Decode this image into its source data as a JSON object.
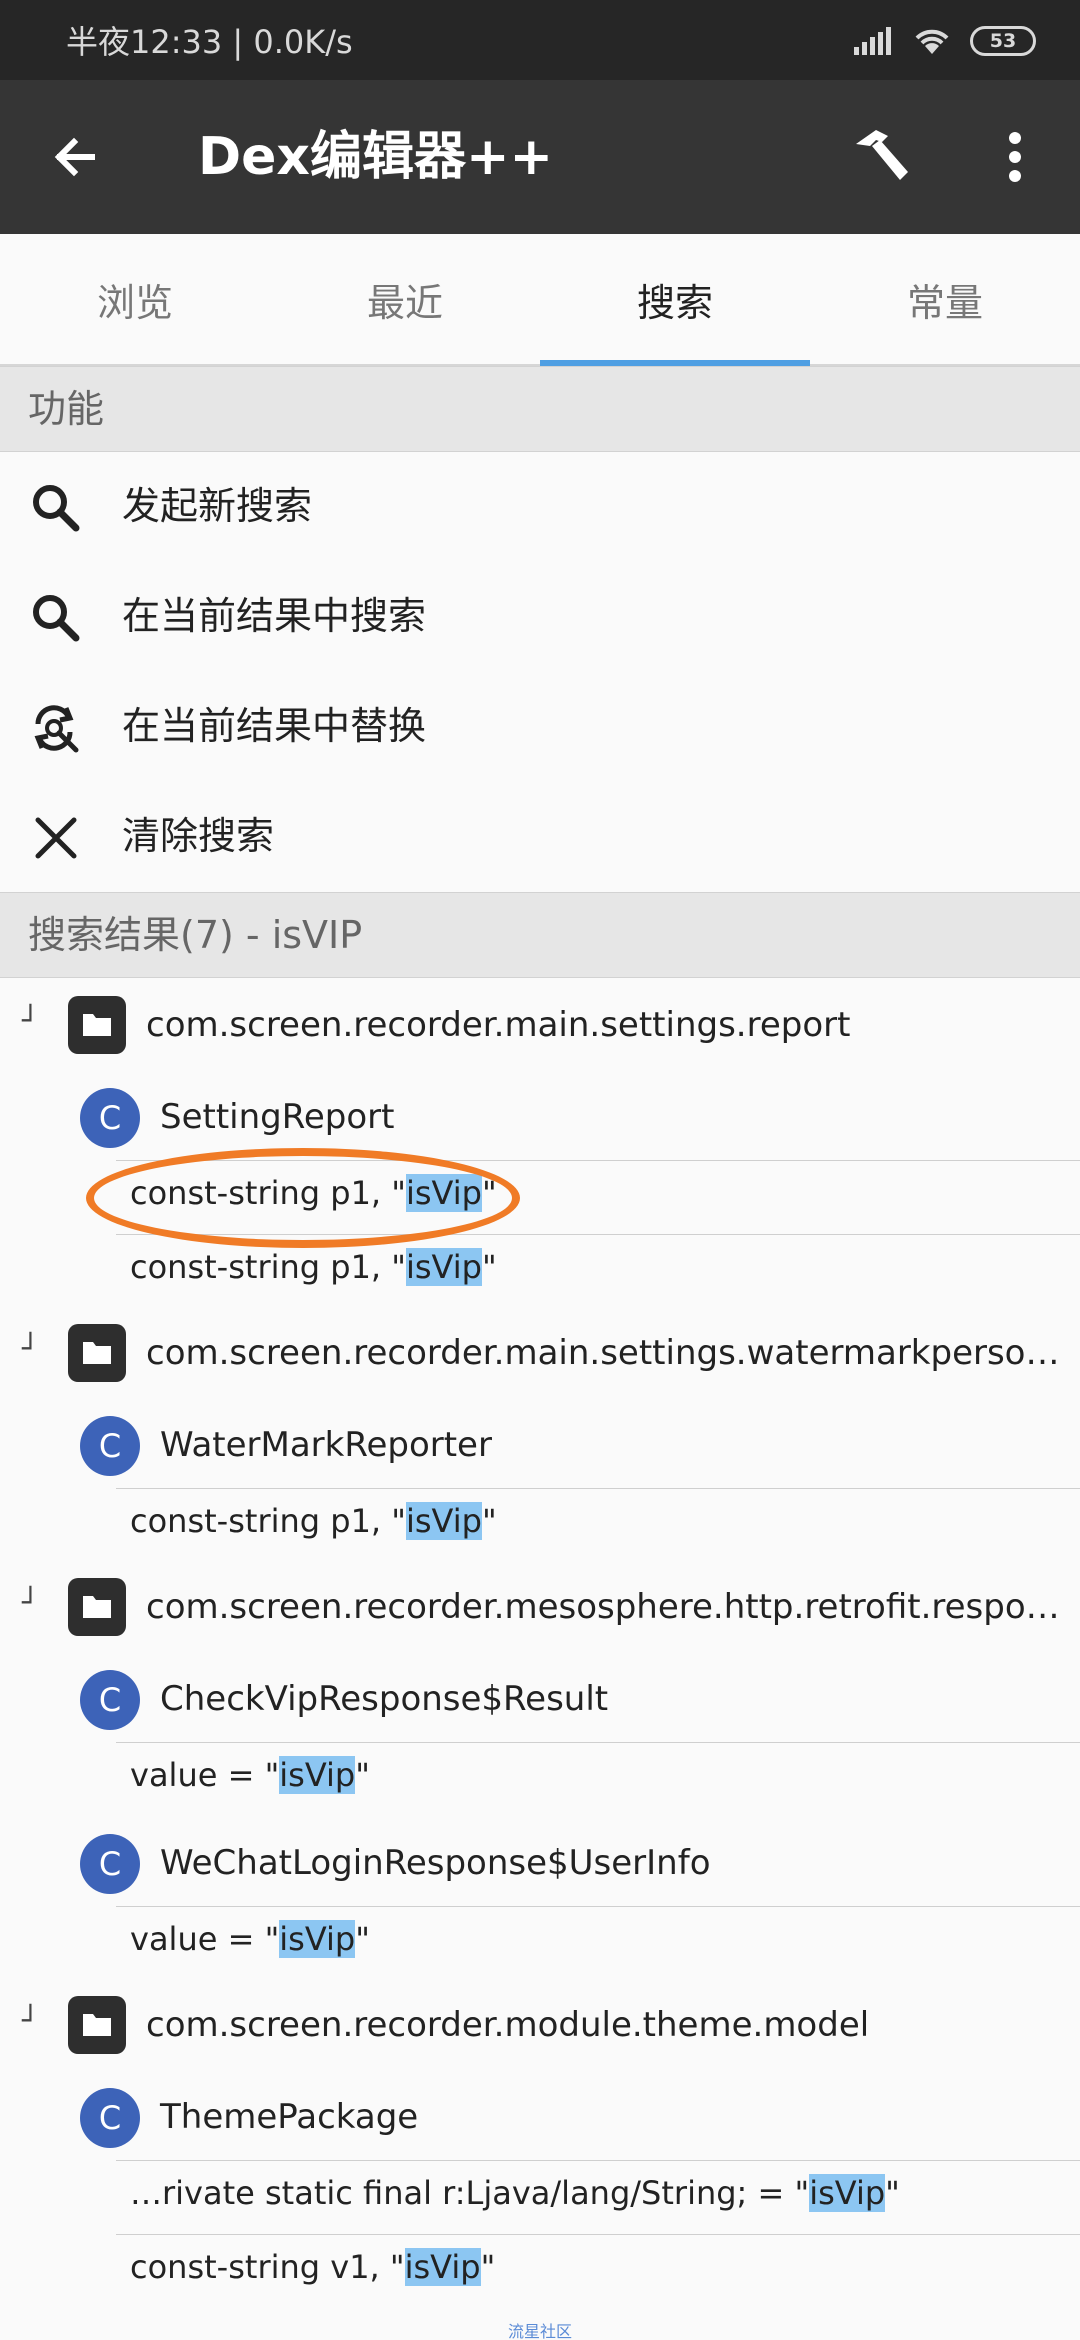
{
  "status": {
    "time": "半夜12:33 | 0.0K/s",
    "battery": "53"
  },
  "appbar": {
    "title": "Dex编辑器++"
  },
  "tabs": [
    {
      "label": "浏览"
    },
    {
      "label": "最近"
    },
    {
      "label": "搜索"
    },
    {
      "label": "常量"
    }
  ],
  "functions_header": "功能",
  "actions": [
    {
      "label": "发起新搜索",
      "icon": "search-icon"
    },
    {
      "label": "在当前结果中搜索",
      "icon": "search-icon"
    },
    {
      "label": "在当前结果中替换",
      "icon": "replace-icon"
    },
    {
      "label": "清除搜索",
      "icon": "close-icon"
    }
  ],
  "results_header": "搜索结果(7) - isVIP",
  "results": {
    "pkg1": {
      "name": "com.screen.recorder.main.settings.report"
    },
    "cls1": {
      "badge": "C",
      "name": "SettingReport"
    },
    "r1": {
      "pre": "const-string p1, \"",
      "match": "isVip",
      "post": "\""
    },
    "r2": {
      "pre": "const-string p1, \"",
      "match": "isVip",
      "post": "\""
    },
    "pkg2": {
      "name": "com.screen.recorder.main.settings.watermarkpersonal…"
    },
    "cls2": {
      "badge": "C",
      "name": "WaterMarkReporter"
    },
    "r3": {
      "pre": "const-string p1, \"",
      "match": "isVip",
      "post": "\""
    },
    "pkg3": {
      "name": "com.screen.recorder.mesosphere.http.retrofit.respons…"
    },
    "cls3": {
      "badge": "C",
      "name": "CheckVipResponse$Result"
    },
    "r4": {
      "pre": "value = \"",
      "match": "isVip",
      "post": "\""
    },
    "cls4": {
      "badge": "C",
      "name": "WeChatLoginResponse$UserInfo"
    },
    "r5": {
      "pre": "value = \"",
      "match": "isVip",
      "post": "\""
    },
    "pkg4": {
      "name": "com.screen.recorder.module.theme.model"
    },
    "cls5": {
      "badge": "C",
      "name": "ThemePackage"
    },
    "r6": {
      "pre": "…rivate static final r:Ljava/lang/String; = \"",
      "match": "isVip",
      "post": "\""
    },
    "r7": {
      "pre": "const-string v1, \"",
      "match": "isVip",
      "post": "\""
    }
  },
  "watermark": "流星社区",
  "colors": {
    "accent": "#4f9fe3",
    "appbar": "#353535",
    "class_badge": "#3d63b8",
    "match_highlight": "#8cc6f2",
    "annotation_oval": "#f07b26"
  }
}
